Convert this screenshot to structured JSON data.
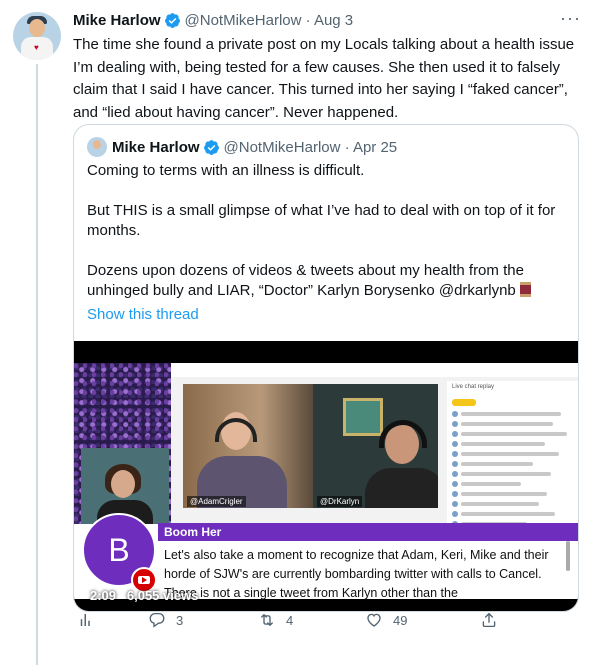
{
  "tweet": {
    "author_name": "Mike Harlow",
    "handle_date": "@NotMikeHarlow · Aug 3",
    "more_label": "···",
    "text": "The time she found a private post on my Locals talking about a health issue I’m dealing with, being tested for a few causes. She then used it to falsely claim that I said I have cancer. This turned into her saying I “faked cancer”, and “lied about having cancer”. Never happened."
  },
  "quote": {
    "author_name": "Mike Harlow",
    "handle_date": "@NotMikeHarlow · Apr 25",
    "paragraphs": [
      "Coming to terms with an illness is difficult.",
      "But THIS is a small glimpse of what I’ve had to deal with on top of it for months.",
      "Dozens upon dozens of videos & tweets about my health from the unhinged bully and LIAR, “Doctor” Karlyn Borysenko @drkarlynb"
    ],
    "show_thread": "Show this thread"
  },
  "video": {
    "tag_left": "@AdamCrigler",
    "tag_right": "@DrKarlyn",
    "chat_title": "Live chat replay",
    "lower_third_name": "Boom Her",
    "lower_third_text": "Let's also take a moment to recognize that Adam, Keri, Mike and their horde of SJW's are currently bombarding twitter with calls to Cancel. There is not a single tweet from Karlyn other than the",
    "badge_letter": "B",
    "duration": "2:09",
    "views": "6,055 views"
  },
  "actions": {
    "replies": "3",
    "retweets": "4",
    "likes": "49"
  },
  "colors": {
    "accent": "#1d9bf0",
    "text_secondary": "#536471",
    "lower_third": "#6f2dbd",
    "youtube_red": "#d60000"
  },
  "icons": [
    "verified-badge-icon",
    "more-icon",
    "spool-emoji-icon",
    "analytics-icon",
    "reply-icon",
    "retweet-icon",
    "like-icon",
    "share-icon",
    "youtube-icon"
  ]
}
